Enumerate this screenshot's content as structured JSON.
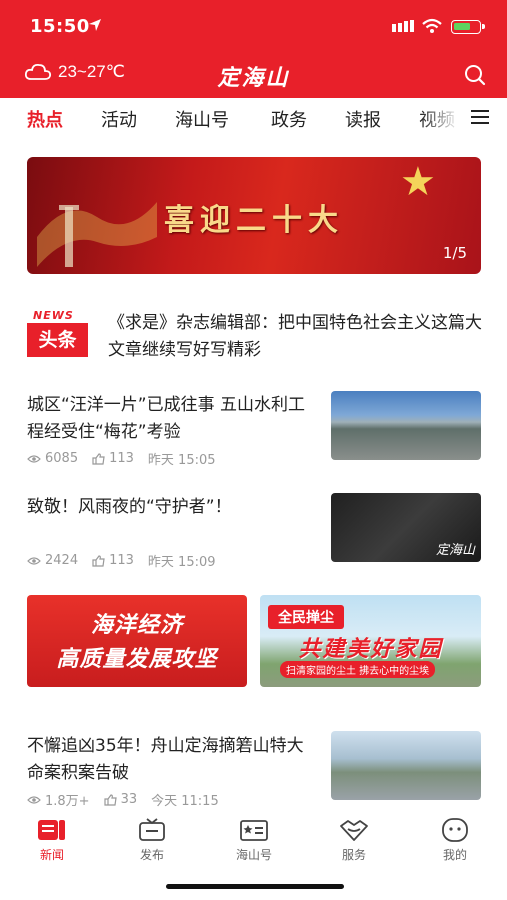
{
  "status_bar": {
    "time": "15:50"
  },
  "header": {
    "weather": "23~27℃",
    "logo_text": "定海山"
  },
  "tabs": [
    {
      "label": "热点",
      "active": true
    },
    {
      "label": "活动",
      "active": false
    },
    {
      "label": "海山号",
      "active": false
    },
    {
      "label": "政务",
      "active": false
    },
    {
      "label": "读报",
      "active": false
    },
    {
      "label": "视频",
      "active": false
    }
  ],
  "banner": {
    "title": "喜迎二十大",
    "pager": "1/5"
  },
  "headline": {
    "badge_top": "NEWS",
    "badge_main": "头条",
    "text": "《求是》杂志编辑部：把中国特色社会主义这篇大文章继续写好写精彩"
  },
  "news": [
    {
      "title": "城区“汪洋一片”已成往事 五山水利工程经受住“梅花”考验",
      "views": "6085",
      "likes": "113",
      "time": "昨天 15:05"
    },
    {
      "title": "致敬！风雨夜的“守护者”！",
      "views": "2424",
      "likes": "113",
      "time": "昨天 15:09",
      "thumb_mark": "定海山"
    },
    {
      "title": "不懈追凶35年！舟山定海摘箬山特大命案积案告破",
      "views": "1.8万+",
      "likes": "33",
      "time": "今天 11:15"
    }
  ],
  "promos": [
    {
      "line1": "海洋经济",
      "line2": "高质量发展攻坚"
    },
    {
      "pill": "全民掸尘",
      "big": "共建美好家园",
      "small": "扫清家园的尘土 拂去心中的尘埃"
    }
  ],
  "bottom_nav": [
    {
      "label": "新闻",
      "icon": "news-icon",
      "active": true
    },
    {
      "label": "发布",
      "icon": "tv-icon",
      "active": false
    },
    {
      "label": "海山号",
      "icon": "id-card-icon",
      "active": false
    },
    {
      "label": "服务",
      "icon": "heart-hands-icon",
      "active": false
    },
    {
      "label": "我的",
      "icon": "smile-icon",
      "active": false
    }
  ],
  "colors": {
    "brand_red": "#e8202a",
    "meta_gray": "#999999"
  }
}
